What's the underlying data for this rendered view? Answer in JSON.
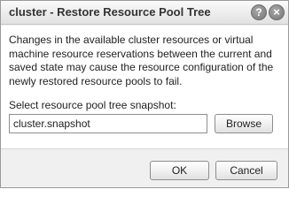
{
  "dialog": {
    "title": "cluster - Restore Resource Pool Tree",
    "help_icon": "?",
    "close_icon": "×",
    "description": "Changes in the available cluster resources or virtual machine resource reservations between the current and saved state may cause the resource configuration of the newly restored resource pools to fail.",
    "snapshot_label": "Select resource pool tree snapshot:",
    "snapshot_value": "cluster.snapshot",
    "browse_label": "Browse",
    "ok_label": "OK",
    "cancel_label": "Cancel"
  }
}
